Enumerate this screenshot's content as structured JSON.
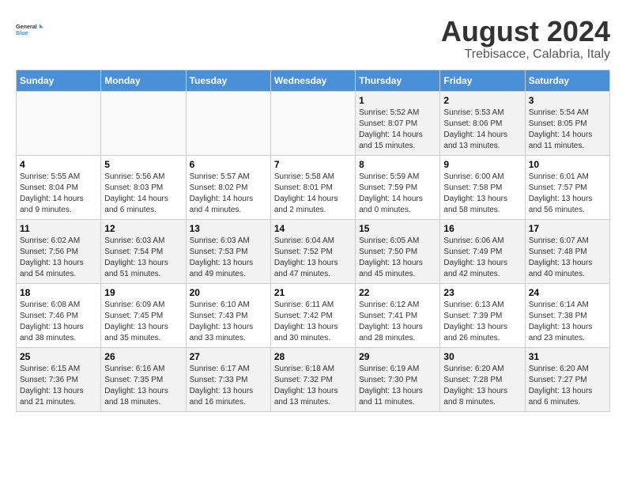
{
  "logo": {
    "line1": "General",
    "line2": "Blue"
  },
  "title": "August 2024",
  "subtitle": "Trebisacce, Calabria, Italy",
  "days_header": [
    "Sunday",
    "Monday",
    "Tuesday",
    "Wednesday",
    "Thursday",
    "Friday",
    "Saturday"
  ],
  "weeks": [
    [
      {
        "num": "",
        "info": ""
      },
      {
        "num": "",
        "info": ""
      },
      {
        "num": "",
        "info": ""
      },
      {
        "num": "",
        "info": ""
      },
      {
        "num": "1",
        "info": "Sunrise: 5:52 AM\nSunset: 8:07 PM\nDaylight: 14 hours\nand 15 minutes."
      },
      {
        "num": "2",
        "info": "Sunrise: 5:53 AM\nSunset: 8:06 PM\nDaylight: 14 hours\nand 13 minutes."
      },
      {
        "num": "3",
        "info": "Sunrise: 5:54 AM\nSunset: 8:05 PM\nDaylight: 14 hours\nand 11 minutes."
      }
    ],
    [
      {
        "num": "4",
        "info": "Sunrise: 5:55 AM\nSunset: 8:04 PM\nDaylight: 14 hours\nand 9 minutes."
      },
      {
        "num": "5",
        "info": "Sunrise: 5:56 AM\nSunset: 8:03 PM\nDaylight: 14 hours\nand 6 minutes."
      },
      {
        "num": "6",
        "info": "Sunrise: 5:57 AM\nSunset: 8:02 PM\nDaylight: 14 hours\nand 4 minutes."
      },
      {
        "num": "7",
        "info": "Sunrise: 5:58 AM\nSunset: 8:01 PM\nDaylight: 14 hours\nand 2 minutes."
      },
      {
        "num": "8",
        "info": "Sunrise: 5:59 AM\nSunset: 7:59 PM\nDaylight: 14 hours\nand 0 minutes."
      },
      {
        "num": "9",
        "info": "Sunrise: 6:00 AM\nSunset: 7:58 PM\nDaylight: 13 hours\nand 58 minutes."
      },
      {
        "num": "10",
        "info": "Sunrise: 6:01 AM\nSunset: 7:57 PM\nDaylight: 13 hours\nand 56 minutes."
      }
    ],
    [
      {
        "num": "11",
        "info": "Sunrise: 6:02 AM\nSunset: 7:56 PM\nDaylight: 13 hours\nand 54 minutes."
      },
      {
        "num": "12",
        "info": "Sunrise: 6:03 AM\nSunset: 7:54 PM\nDaylight: 13 hours\nand 51 minutes."
      },
      {
        "num": "13",
        "info": "Sunrise: 6:03 AM\nSunset: 7:53 PM\nDaylight: 13 hours\nand 49 minutes."
      },
      {
        "num": "14",
        "info": "Sunrise: 6:04 AM\nSunset: 7:52 PM\nDaylight: 13 hours\nand 47 minutes."
      },
      {
        "num": "15",
        "info": "Sunrise: 6:05 AM\nSunset: 7:50 PM\nDaylight: 13 hours\nand 45 minutes."
      },
      {
        "num": "16",
        "info": "Sunrise: 6:06 AM\nSunset: 7:49 PM\nDaylight: 13 hours\nand 42 minutes."
      },
      {
        "num": "17",
        "info": "Sunrise: 6:07 AM\nSunset: 7:48 PM\nDaylight: 13 hours\nand 40 minutes."
      }
    ],
    [
      {
        "num": "18",
        "info": "Sunrise: 6:08 AM\nSunset: 7:46 PM\nDaylight: 13 hours\nand 38 minutes."
      },
      {
        "num": "19",
        "info": "Sunrise: 6:09 AM\nSunset: 7:45 PM\nDaylight: 13 hours\nand 35 minutes."
      },
      {
        "num": "20",
        "info": "Sunrise: 6:10 AM\nSunset: 7:43 PM\nDaylight: 13 hours\nand 33 minutes."
      },
      {
        "num": "21",
        "info": "Sunrise: 6:11 AM\nSunset: 7:42 PM\nDaylight: 13 hours\nand 30 minutes."
      },
      {
        "num": "22",
        "info": "Sunrise: 6:12 AM\nSunset: 7:41 PM\nDaylight: 13 hours\nand 28 minutes."
      },
      {
        "num": "23",
        "info": "Sunrise: 6:13 AM\nSunset: 7:39 PM\nDaylight: 13 hours\nand 26 minutes."
      },
      {
        "num": "24",
        "info": "Sunrise: 6:14 AM\nSunset: 7:38 PM\nDaylight: 13 hours\nand 23 minutes."
      }
    ],
    [
      {
        "num": "25",
        "info": "Sunrise: 6:15 AM\nSunset: 7:36 PM\nDaylight: 13 hours\nand 21 minutes."
      },
      {
        "num": "26",
        "info": "Sunrise: 6:16 AM\nSunset: 7:35 PM\nDaylight: 13 hours\nand 18 minutes."
      },
      {
        "num": "27",
        "info": "Sunrise: 6:17 AM\nSunset: 7:33 PM\nDaylight: 13 hours\nand 16 minutes."
      },
      {
        "num": "28",
        "info": "Sunrise: 6:18 AM\nSunset: 7:32 PM\nDaylight: 13 hours\nand 13 minutes."
      },
      {
        "num": "29",
        "info": "Sunrise: 6:19 AM\nSunset: 7:30 PM\nDaylight: 13 hours\nand 11 minutes."
      },
      {
        "num": "30",
        "info": "Sunrise: 6:20 AM\nSunset: 7:28 PM\nDaylight: 13 hours\nand 8 minutes."
      },
      {
        "num": "31",
        "info": "Sunrise: 6:20 AM\nSunset: 7:27 PM\nDaylight: 13 hours\nand 6 minutes."
      }
    ]
  ]
}
